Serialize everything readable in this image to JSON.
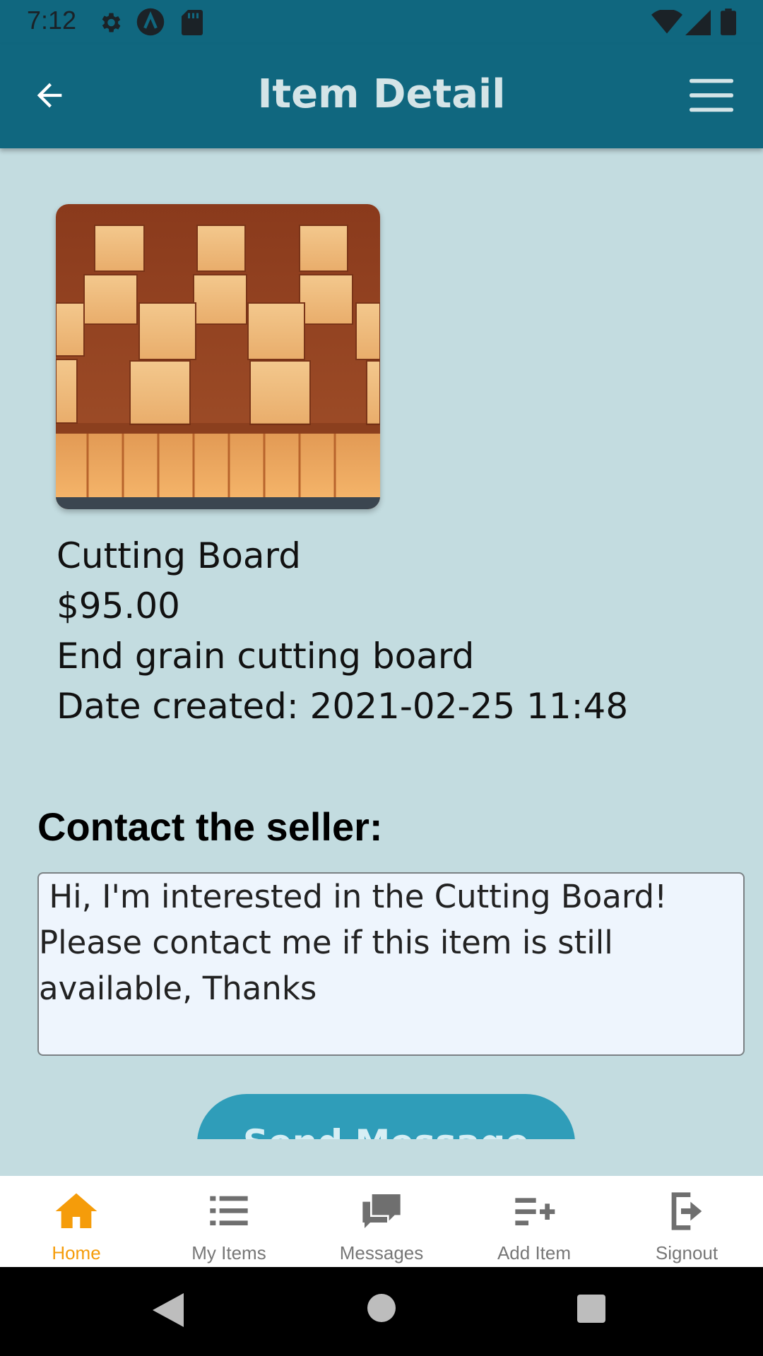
{
  "status_bar": {
    "time": "7:12",
    "icons_left": [
      "gear-icon",
      "a-circle-icon",
      "sd-card-icon"
    ],
    "icons_right": [
      "wifi-icon",
      "signal-icon",
      "battery-icon"
    ]
  },
  "app_bar": {
    "title": "Item Detail",
    "back_icon": "arrow-left-icon",
    "menu_icon": "hamburger-menu-icon",
    "color": "#10677f"
  },
  "item": {
    "image": "cutting-board-photo",
    "name": "Cutting Board",
    "price": "$95.00",
    "description": "End grain cutting board",
    "date_created": "Date created: 2021-02-25 11:48"
  },
  "contact": {
    "heading": "Contact the seller:",
    "message": " Hi, I'm interested in the Cutting Board! Please contact me if this item is still available, Thanks",
    "send_label": "Send Message"
  },
  "bottom_nav": {
    "items": [
      {
        "label": "Home",
        "icon": "home-icon",
        "active": true
      },
      {
        "label": "My Items",
        "icon": "list-icon",
        "active": false
      },
      {
        "label": "Messages",
        "icon": "chat-bubbles-icon",
        "active": false
      },
      {
        "label": "Add Item",
        "icon": "playlist-add-icon",
        "active": false
      },
      {
        "label": "Signout",
        "icon": "logout-icon",
        "active": false
      }
    ],
    "active_color": "#f59c0a",
    "inactive_color": "#777777"
  },
  "system_nav": {
    "buttons": [
      "back-triangle-icon",
      "home-circle-icon",
      "recents-square-icon"
    ]
  }
}
